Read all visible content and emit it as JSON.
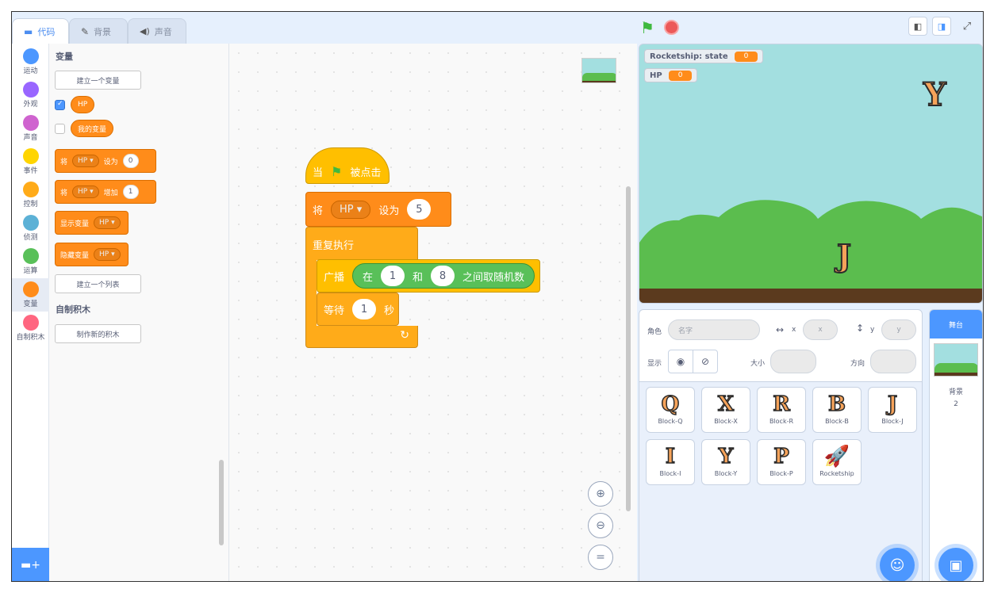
{
  "tabs": {
    "code": "代码",
    "backdrops": "背景",
    "sounds": "声音"
  },
  "categories": [
    {
      "label": "运动",
      "color": "#4c97ff"
    },
    {
      "label": "外观",
      "color": "#9966ff"
    },
    {
      "label": "声音",
      "color": "#cf63cf"
    },
    {
      "label": "事件",
      "color": "#ffd500"
    },
    {
      "label": "控制",
      "color": "#ffab19"
    },
    {
      "label": "侦测",
      "color": "#5cb1d6"
    },
    {
      "label": "运算",
      "color": "#59c059"
    },
    {
      "label": "变量",
      "color": "#ff8c1a"
    },
    {
      "label": "自制积木",
      "color": "#ff6680"
    }
  ],
  "palette": {
    "variables_title": "变量",
    "make_variable": "建立一个变量",
    "var_hp": "HP",
    "var_mine": "我的变量",
    "set_block": {
      "prefix": "将",
      "var": "HP",
      "verb": "设为",
      "value": "0"
    },
    "change_block": {
      "prefix": "将",
      "var": "HP",
      "verb": "增加",
      "value": "1"
    },
    "show_block": {
      "label": "显示变量",
      "var": "HP"
    },
    "hide_block": {
      "label": "隐藏变量",
      "var": "HP"
    },
    "make_list": "建立一个列表",
    "my_blocks_title": "自制积木",
    "make_block": "制作新的积木"
  },
  "script": {
    "hat": {
      "when": "当",
      "clicked": "被点击"
    },
    "set": {
      "prefix": "将",
      "var": "HP",
      "verb": "设为",
      "value": "5"
    },
    "forever": "重复执行",
    "broadcast": {
      "label": "广播",
      "in": "在",
      "from": "1",
      "and": "和",
      "to": "8",
      "random": "之间取随机数"
    },
    "wait": {
      "label": "等待",
      "value": "1",
      "unit": "秒"
    }
  },
  "zoom": {
    "in": "+",
    "out": "−",
    "reset": "="
  },
  "stage": {
    "monitor_state_label": "Rocketship: state",
    "monitor_state_value": "0",
    "monitor_hp_label": "HP",
    "monitor_hp_value": "0",
    "letter_y": "Y",
    "letter_j": "J"
  },
  "sprite_info": {
    "sprite_label": "角色",
    "name_placeholder": "名字",
    "x_label": "x",
    "x_placeholder": "x",
    "y_label": "y",
    "y_placeholder": "y",
    "show_label": "显示",
    "size_label": "大小",
    "direction_label": "方向"
  },
  "sprites": [
    {
      "glyph": "Q",
      "name": "Block-Q"
    },
    {
      "glyph": "X",
      "name": "Block-X"
    },
    {
      "glyph": "R",
      "name": "Block-R"
    },
    {
      "glyph": "B",
      "name": "Block-B"
    },
    {
      "glyph": "J",
      "name": "Block-J"
    },
    {
      "glyph": "I",
      "name": "Block-I"
    },
    {
      "glyph": "Y",
      "name": "Block-Y"
    },
    {
      "glyph": "P",
      "name": "Block-P"
    },
    {
      "glyph": "🚀",
      "name": "Rocketship"
    }
  ],
  "stage_selector": {
    "title": "舞台",
    "backdrops_label": "背景",
    "backdrops_count": "2"
  },
  "colors": {
    "orange": "#ff8c1a",
    "control": "#ffab19",
    "events": "#ffbf00",
    "operators": "#59c059",
    "accent": "#4c97ff"
  }
}
